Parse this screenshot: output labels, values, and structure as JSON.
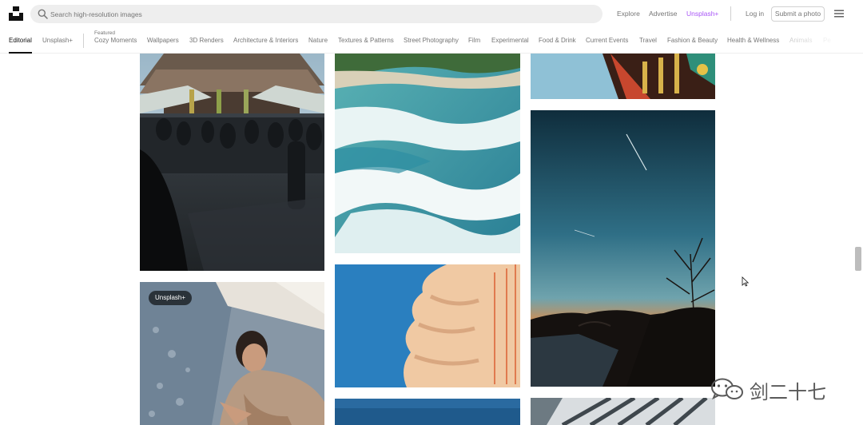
{
  "header": {
    "search_placeholder": "Search high-resolution images",
    "nav": {
      "explore": "Explore",
      "advertise": "Advertise",
      "unsplash_plus": "Unsplash+",
      "login": "Log in",
      "submit": "Submit a photo"
    },
    "colors": {
      "unsplash_plus": "#a855f7",
      "search_bg": "#eeeeee"
    }
  },
  "topics": {
    "editorial": "Editorial",
    "unsplash_plus": "Unsplash+",
    "featured_label": "Featured",
    "items": [
      "Cozy Moments",
      "Wallpapers",
      "3D Renders",
      "Architecture & Interiors",
      "Nature",
      "Textures & Patterns",
      "Street Photography",
      "Film",
      "Experimental",
      "Food & Drink",
      "Current Events",
      "Travel",
      "Fashion & Beauty",
      "Health & Wellness",
      "Animals",
      "Pe"
    ]
  },
  "photos": {
    "badge": "Unsplash+"
  },
  "watermark": {
    "text": "剑二十七"
  }
}
